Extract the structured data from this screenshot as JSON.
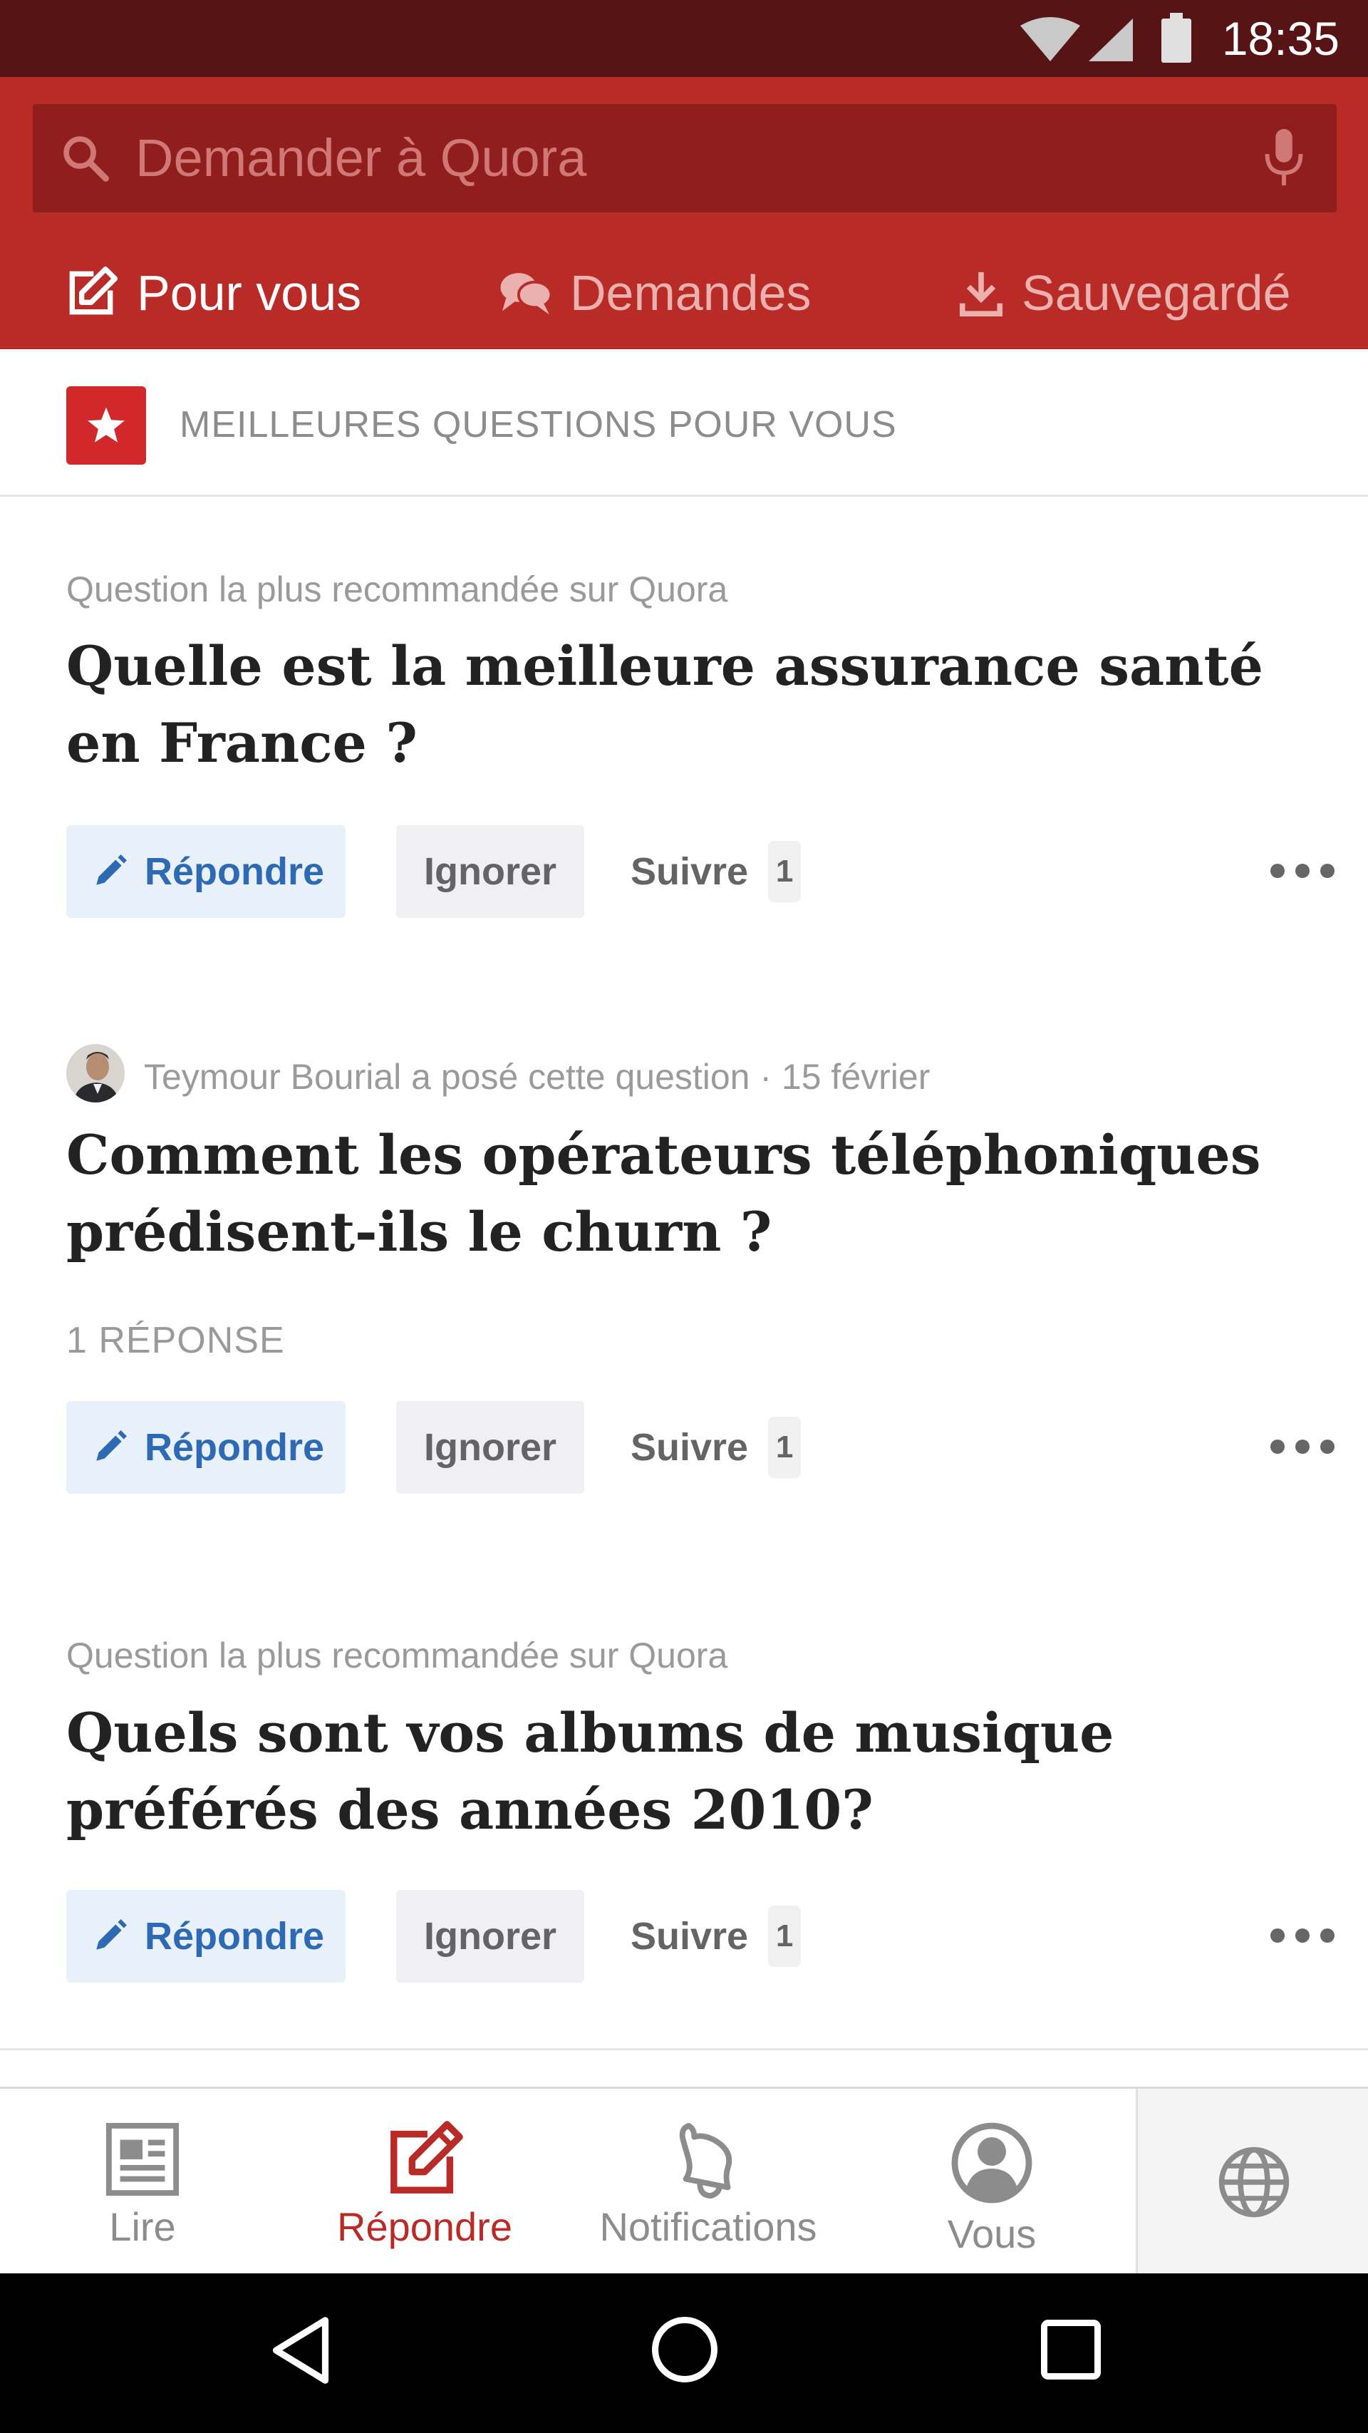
{
  "status_bar": {
    "time": "18:35"
  },
  "search": {
    "placeholder": "Demander à Quora"
  },
  "tabs": [
    {
      "label": "Pour vous",
      "active": true,
      "icon": "edit-icon"
    },
    {
      "label": "Demandes",
      "active": false,
      "icon": "chat-bubbles-icon"
    },
    {
      "label": "Sauvegardé",
      "active": false,
      "icon": "download-icon"
    }
  ],
  "section": {
    "title": "MEILLEURES QUESTIONS POUR VOUS",
    "icon": "star-icon"
  },
  "questions": [
    {
      "meta": "Question la plus recommandée sur Quora",
      "title": "Quelle est la meilleure assurance santé en France ?",
      "answer_label": "Répondre",
      "ignore_label": "Ignorer",
      "follow_label": "Suivre",
      "follow_count": "1"
    },
    {
      "meta": "Teymour Bourial a posé cette question · 15 février",
      "title": "Comment les opérateurs téléphoniques prédisent-ils le churn ?",
      "answers_count": "1 RÉPONSE",
      "answer_label": "Répondre",
      "ignore_label": "Ignorer",
      "follow_label": "Suivre",
      "follow_count": "1"
    },
    {
      "meta": "Question la plus recommandée sur Quora",
      "title": "Quels sont vos albums de musique préférés des années 2010?",
      "answer_label": "Répondre",
      "ignore_label": "Ignorer",
      "follow_label": "Suivre",
      "follow_count": "1"
    }
  ],
  "bottom_nav": [
    {
      "label": "Lire",
      "active": false,
      "icon": "newspaper-icon"
    },
    {
      "label": "Répondre",
      "active": true,
      "icon": "edit-icon"
    },
    {
      "label": "Notifications",
      "active": false,
      "icon": "bell-icon"
    },
    {
      "label": "Vous",
      "active": false,
      "icon": "user-icon"
    }
  ],
  "colors": {
    "brand_red": "#b92b27",
    "status_bar": "#561414",
    "answer_blue": "#2e69b3",
    "active_nav": "#b92b27"
  }
}
